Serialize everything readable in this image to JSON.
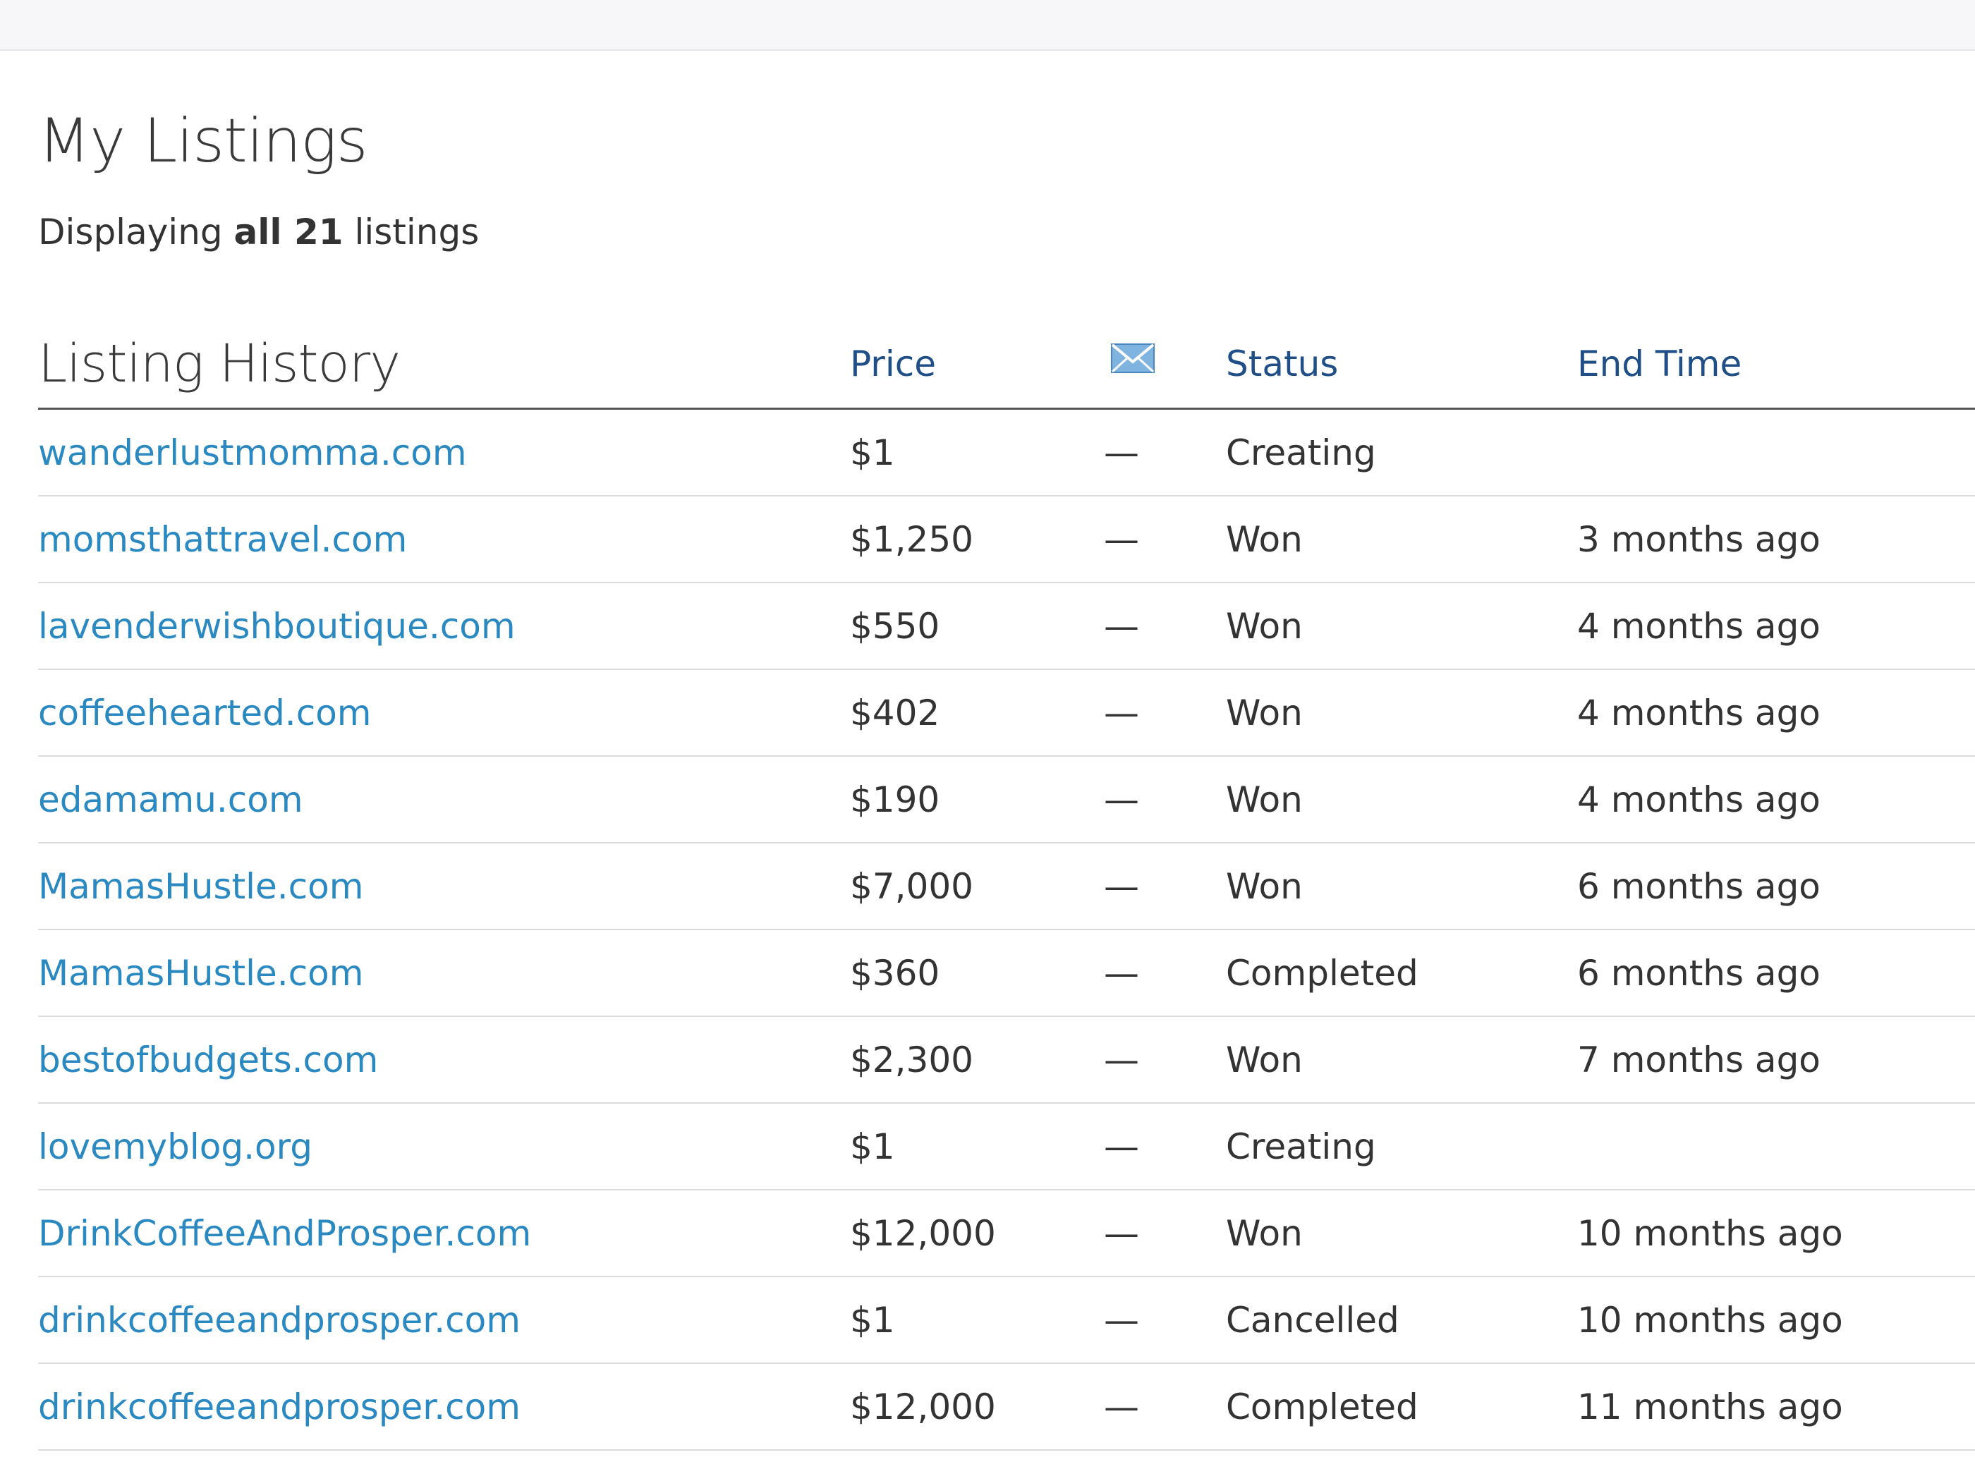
{
  "page": {
    "title": "My Listings",
    "subtitle_prefix": "Displaying",
    "subtitle_bold": "all 21",
    "subtitle_suffix": "listings"
  },
  "table": {
    "headers": {
      "history": "Listing History",
      "price": "Price",
      "message_icon": "envelope-icon",
      "status": "Status",
      "end_time": "End Time"
    },
    "rows": [
      {
        "name": "wanderlustmomma.com",
        "price": "$1",
        "messages": "—",
        "status": "Creating",
        "end_time": ""
      },
      {
        "name": "momsthattravel.com",
        "price": "$1,250",
        "messages": "—",
        "status": "Won",
        "end_time": "3 months ago"
      },
      {
        "name": "lavenderwishboutique.com",
        "price": "$550",
        "messages": "—",
        "status": "Won",
        "end_time": "4 months ago"
      },
      {
        "name": "coffeehearted.com",
        "price": "$402",
        "messages": "—",
        "status": "Won",
        "end_time": "4 months ago"
      },
      {
        "name": "edamamu.com",
        "price": "$190",
        "messages": "—",
        "status": "Won",
        "end_time": "4 months ago"
      },
      {
        "name": "MamasHustle.com",
        "price": "$7,000",
        "messages": "—",
        "status": "Won",
        "end_time": "6 months ago"
      },
      {
        "name": "MamasHustle.com",
        "price": "$360",
        "messages": "—",
        "status": "Completed",
        "end_time": "6 months ago"
      },
      {
        "name": "bestofbudgets.com",
        "price": "$2,300",
        "messages": "—",
        "status": "Won",
        "end_time": "7 months ago"
      },
      {
        "name": "lovemyblog.org",
        "price": "$1",
        "messages": "—",
        "status": "Creating",
        "end_time": ""
      },
      {
        "name": "DrinkCoffeeAndProsper.com",
        "price": "$12,000",
        "messages": "—",
        "status": "Won",
        "end_time": "10 months ago"
      },
      {
        "name": "drinkcoffeeandprosper.com",
        "price": "$1",
        "messages": "—",
        "status": "Cancelled",
        "end_time": "10 months ago"
      },
      {
        "name": "drinkcoffeeandprosper.com",
        "price": "$12,000",
        "messages": "—",
        "status": "Completed",
        "end_time": "11 months ago"
      }
    ]
  },
  "colors": {
    "link": "#2b89c2",
    "header_link": "#1f4f86",
    "text": "#333333",
    "rule": "#dcdcdc"
  }
}
